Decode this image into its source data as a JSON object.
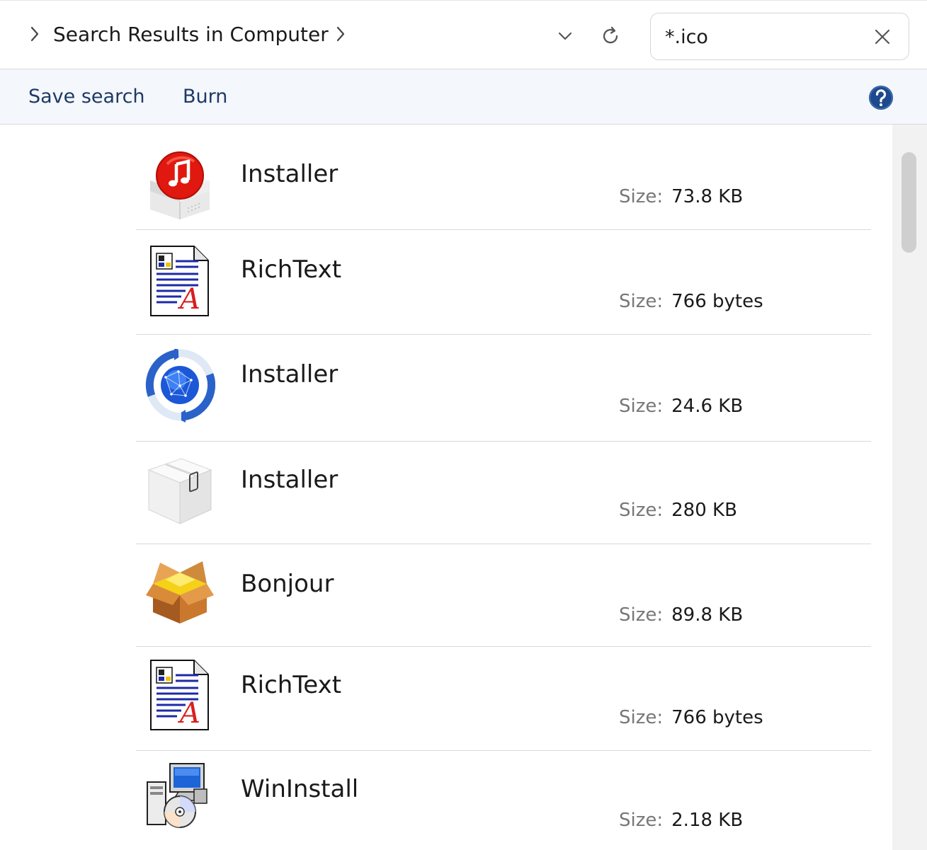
{
  "address": {
    "title": "Search Results in Computer",
    "search_value": "*.ico"
  },
  "toolbar": {
    "save_search_label": "Save search",
    "burn_label": "Burn"
  },
  "results": [
    {
      "name": "Installer",
      "size_label": "Size:",
      "size": "73.8 KB",
      "icon": "itunes-installer-icon"
    },
    {
      "name": "RichText",
      "size_label": "Size:",
      "size": "766 bytes",
      "icon": "richtext-document-icon"
    },
    {
      "name": "Installer",
      "size_label": "Size:",
      "size": "24.6 KB",
      "icon": "globe-update-icon"
    },
    {
      "name": "Installer",
      "size_label": "Size:",
      "size": "280 KB",
      "icon": "device-box-icon"
    },
    {
      "name": "Bonjour",
      "size_label": "Size:",
      "size": "89.8 KB",
      "icon": "open-package-icon"
    },
    {
      "name": "RichText",
      "size_label": "Size:",
      "size": "766 bytes",
      "icon": "richtext-document-icon"
    },
    {
      "name": "WinInstall",
      "size_label": "Size:",
      "size": "2.18 KB",
      "icon": "computer-cd-install-icon"
    }
  ],
  "colors": {
    "toolbar_text": "#1d3a66",
    "help_badge": "#1d4a8c",
    "divider": "#d9d9d9"
  }
}
